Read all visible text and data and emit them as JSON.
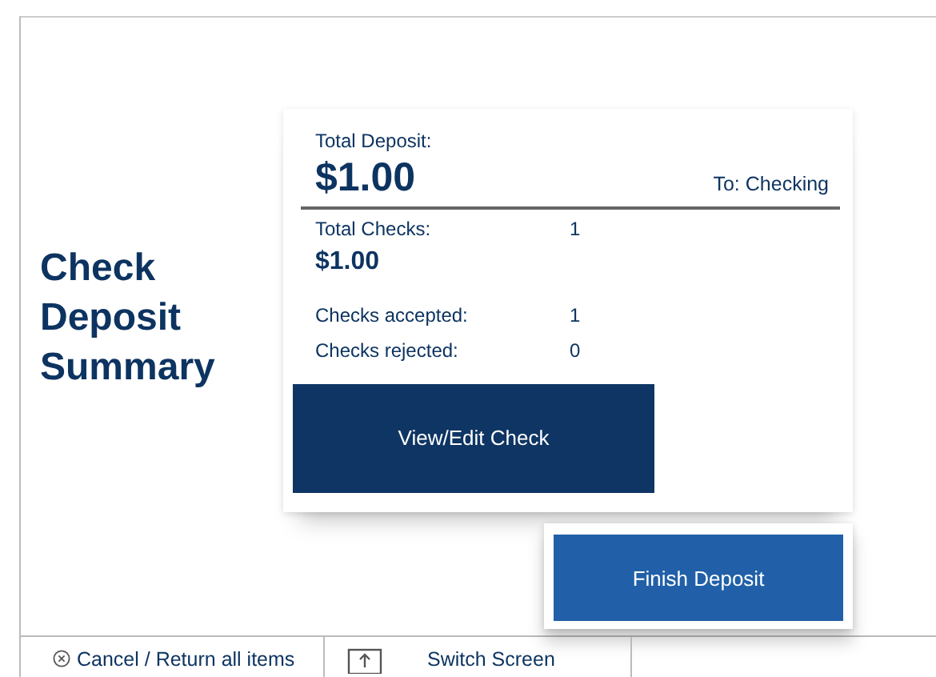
{
  "heading": "Check Deposit Summary",
  "summary": {
    "total_deposit_label": "Total Deposit:",
    "total_deposit_amount": "$1.00",
    "destination": "To: Checking",
    "total_checks_label": "Total Checks:",
    "total_checks_count": "1",
    "total_checks_amount": "$1.00",
    "rows": [
      {
        "label": "Checks accepted:",
        "value": "1"
      },
      {
        "label": "Checks rejected:",
        "value": "0"
      }
    ]
  },
  "view_edit_button": "View/Edit Check",
  "finish_button": "Finish Deposit",
  "bottom_bar": [
    {
      "kind": "cancel",
      "label": "Cancel / Return all items"
    },
    {
      "kind": "switch",
      "label": "Switch Screen"
    }
  ]
}
